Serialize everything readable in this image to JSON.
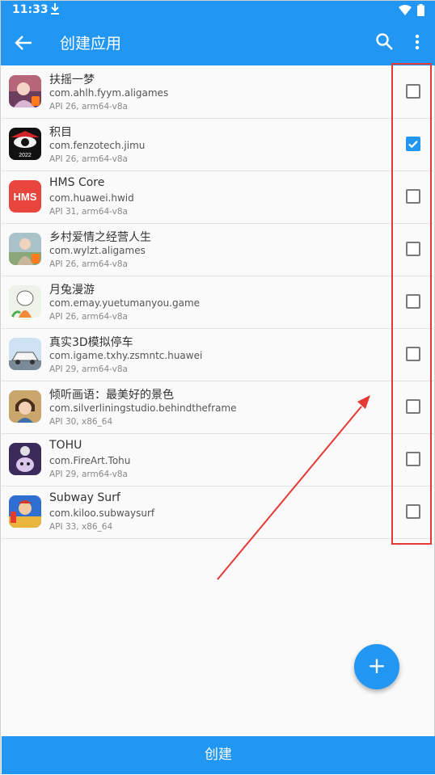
{
  "status_bar": {
    "time": "11:33"
  },
  "app_bar": {
    "title": "创建应用"
  },
  "apps": [
    {
      "name": "扶摇一梦",
      "package": "com.ahlh.fyym.aligames",
      "api": "API 26, arm64-v8a",
      "checked": false
    },
    {
      "name": "积目",
      "package": "com.fenzotech.jimu",
      "api": "API 26, arm64-v8a",
      "checked": true,
      "icon_text": "2022"
    },
    {
      "name": "HMS Core",
      "package": "com.huawei.hwid",
      "api": "API 31, arm64-v8a",
      "checked": false,
      "icon_text": "HMS"
    },
    {
      "name": "乡村爱情之经营人生",
      "package": "com.wylzt.aligames",
      "api": "API 26, arm64-v8a",
      "checked": false
    },
    {
      "name": "月兔漫游",
      "package": "com.emay.yuetumanyou.game",
      "api": "API 26, arm64-v8a",
      "checked": false
    },
    {
      "name": "真实3D模拟停车",
      "package": "com.igame.txhy.zsmntc.huawei",
      "api": "API 29, arm64-v8a",
      "checked": false
    },
    {
      "name": "倾听画语：最美好的景色",
      "package": "com.silverliningstudio.behindtheframe",
      "api": "API 30, x86_64",
      "checked": false
    },
    {
      "name": "TOHU",
      "package": "com.FireArt.Tohu",
      "api": "API 29, arm64-v8a",
      "checked": false
    },
    {
      "name": "Subway Surf",
      "package": "com.kiloo.subwaysurf",
      "api": "API 33, x86_64",
      "checked": false
    }
  ],
  "fab": {
    "label": "+"
  },
  "bottom_button": {
    "label": "创建"
  },
  "colors": {
    "primary": "#2196f3",
    "annotation": "#e53935"
  }
}
